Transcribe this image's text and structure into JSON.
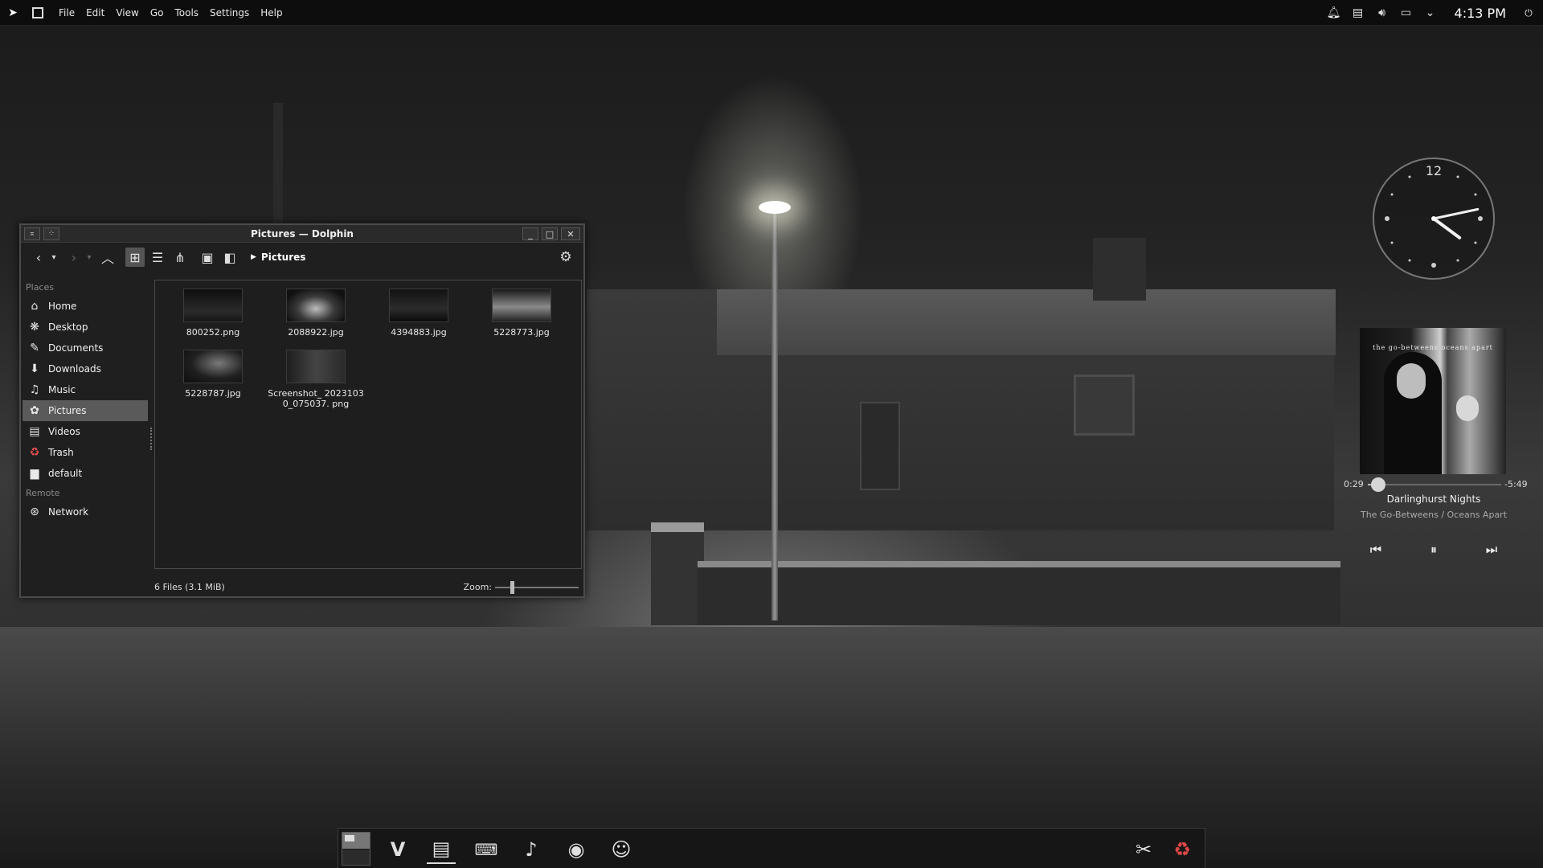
{
  "topbar": {
    "launcher_icon": "kde-logo-icon",
    "menu": [
      "File",
      "Edit",
      "View",
      "Go",
      "Tools",
      "Settings",
      "Help"
    ],
    "tray_icons": [
      "notifications-icon",
      "clipboard-icon",
      "volume-icon",
      "display-icon",
      "chevron-down-icon"
    ],
    "clock": "4:13 PM"
  },
  "window": {
    "title": "Pictures — Dolphin",
    "breadcrumb": "Pictures",
    "places_label": "Places",
    "remote_label": "Remote",
    "places": [
      {
        "label": "Home",
        "icon": "home-icon"
      },
      {
        "label": "Desktop",
        "icon": "desktop-icon"
      },
      {
        "label": "Documents",
        "icon": "documents-icon"
      },
      {
        "label": "Downloads",
        "icon": "downloads-icon"
      },
      {
        "label": "Music",
        "icon": "music-icon"
      },
      {
        "label": "Pictures",
        "icon": "pictures-icon"
      },
      {
        "label": "Videos",
        "icon": "videos-icon"
      },
      {
        "label": "Trash",
        "icon": "trash-icon"
      },
      {
        "label": "default",
        "icon": "folder-icon"
      }
    ],
    "remote": [
      {
        "label": "Network",
        "icon": "network-icon"
      }
    ],
    "files": [
      {
        "name": "800252.png"
      },
      {
        "name": "2088922.jpg"
      },
      {
        "name": "4394883.jpg"
      },
      {
        "name": "5228773.jpg"
      },
      {
        "name": "5228787.jpg"
      },
      {
        "name": "Screenshot_ 20231030_075037. png"
      }
    ],
    "status": "6 Files (3.1 MiB)",
    "zoom_label": "Zoom:",
    "zoom_level": 0.15
  },
  "clock_widget": {
    "twelve": "12",
    "hour": 4,
    "minute": 13
  },
  "media": {
    "album_caption": "the go-betweens oceans apart",
    "elapsed": "0:29",
    "remaining": "-5:49",
    "progress": 0.08,
    "title": "Darlinghurst Nights",
    "artist_album": "The Go-Betweens / Oceans Apart"
  },
  "dock": {
    "apps": [
      "vivaldi-icon",
      "document-viewer-icon",
      "terminal-icon",
      "music-player-icon",
      "eye-icon",
      "discord-icon"
    ],
    "right": [
      "settings-tools-icon",
      "recycle-icon"
    ]
  }
}
